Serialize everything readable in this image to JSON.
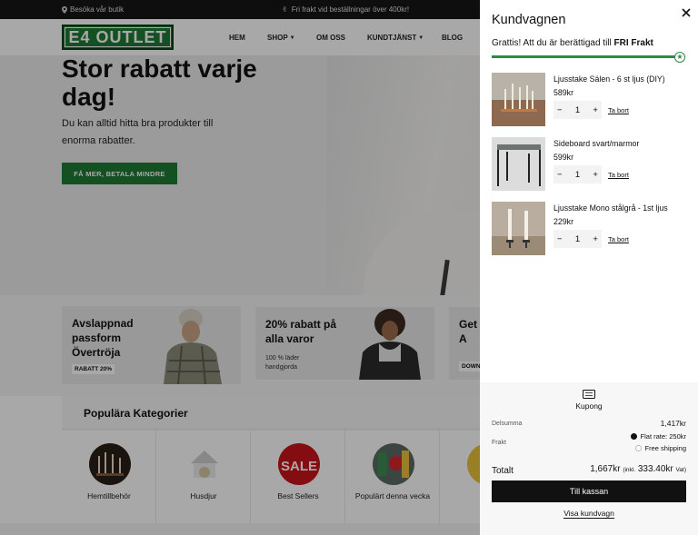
{
  "topbar": {
    "store_link": "Besöka vår butik",
    "promo_text": "Fri frakt vid beställningar över 400kr!"
  },
  "header": {
    "logo_text": "E4 OUTLET",
    "nav": [
      "HEM",
      "SHOP",
      "OM OSS",
      "KUNDTJÄNST",
      "BLOG"
    ]
  },
  "hero": {
    "title": "Stor rabatt varje dag!",
    "subtitle": "Du kan alltid hitta bra produkter till enorma rabatter.",
    "cta": "FÅ MER, BETALA MINDRE"
  },
  "promo_cards": [
    {
      "title": "Avslappnad passform Övertröja",
      "tag": "RABATT 20%"
    },
    {
      "title": "20% rabatt på alla varor",
      "note": "100 % läder handgjorda"
    },
    {
      "title": "Get In A",
      "tag": "DOWN"
    }
  ],
  "categories": {
    "title": "Populära Kategorier",
    "items": [
      "Hemtillbehör",
      "Husdjur",
      "Best Sellers",
      "Populärt denna vecka"
    ]
  },
  "cart": {
    "title": "Kundvagnen",
    "free_shipping_prefix": "Grattis! Att du är berättigad till",
    "free_shipping_bold": "FRI Frakt",
    "progress": 1.0,
    "items": [
      {
        "name": "Ljusstake Sälen - 6 st ljus (DIY)",
        "price": "589kr",
        "qty": "1",
        "remove": "Ta bort"
      },
      {
        "name": "Sideboard svart/marmor",
        "price": "599kr",
        "qty": "1",
        "remove": "Ta bort"
      },
      {
        "name": "Ljusstake Mono stålgrå - 1st ljus",
        "price": "229kr",
        "qty": "1",
        "remove": "Ta bort"
      }
    ],
    "coupon_label": "Kupong",
    "subtotal_label": "Delsumma",
    "subtotal_value": "1,417kr",
    "shipping_label": "Frakt",
    "shipping_options": [
      "Flat rate: 250kr",
      "Free shipping"
    ],
    "total_label": "Totalt",
    "total_value": "1,667kr",
    "total_vat_prefix": "(inkl.",
    "total_vat_value": "333.40kr",
    "total_vat_suffix": "Vat)",
    "checkout_label": "Till kassan",
    "view_cart_label": "Visa kundvagn"
  },
  "colors": {
    "brand_green": "#1d7a34",
    "progress_green": "#2e8b45",
    "checkout_bg": "#111111"
  }
}
